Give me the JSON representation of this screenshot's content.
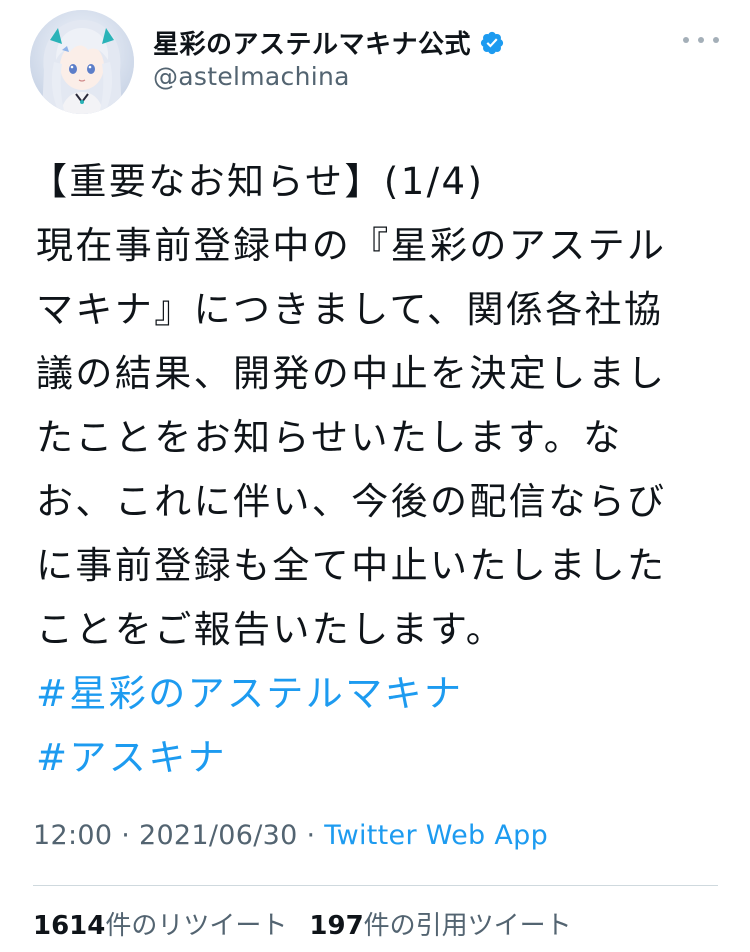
{
  "header": {
    "display_name": "星彩のアステルマキナ公式",
    "handle": "@astelmachina",
    "verified_icon": "verified-badge-icon",
    "more_icon": "more-options-icon"
  },
  "tweet": {
    "lines": [
      "【重要なお知らせ】(1/4)",
      "現在事前登録中の『星彩のアステル",
      "マキナ』につきまして、関係各社協",
      "議の結果、開発の中止を決定しまし",
      "たことをお知らせいたします。な",
      "お、これに伴い、今後の配信ならび",
      "に事前登録も全て中止いたしました",
      "ことをご報告いたします。"
    ],
    "hashtags": [
      "#星彩のアステルマキナ",
      "#アスキナ"
    ]
  },
  "meta": {
    "time": "12:00",
    "separator": " · ",
    "date": "2021/06/30",
    "separator2": " · ",
    "source": "Twitter Web App"
  },
  "stats": {
    "retweets_count": "1614",
    "retweets_label": "件のリツイート",
    "quotes_count": "197",
    "quotes_label": "件の引用ツイート"
  },
  "colors": {
    "link": "#1d9bf0",
    "secondary_text": "#536471",
    "primary_text": "#0f1419",
    "divider": "#cfd9de"
  }
}
